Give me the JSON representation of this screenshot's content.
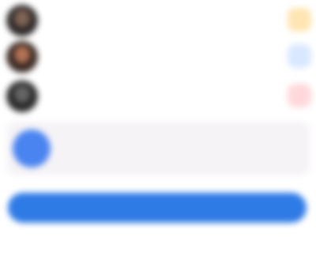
{
  "list": {
    "rows": [
      {
        "avatar": "user-avatar",
        "chip_color": "#ffe5b3"
      },
      {
        "avatar": "user-avatar",
        "chip_color": "#d9e8ff"
      },
      {
        "avatar": "user-avatar",
        "chip_color": "#ffd8db"
      }
    ]
  },
  "card": {
    "icon": "circle-icon"
  },
  "actions": {
    "primary_color": "#2f7be6"
  }
}
